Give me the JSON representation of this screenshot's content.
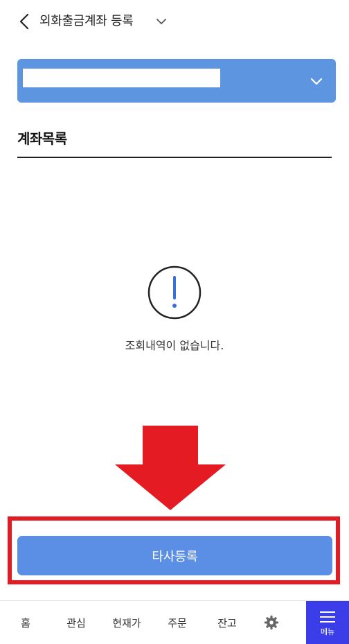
{
  "header": {
    "title": "외화출금계좌 등록"
  },
  "account_select": {
    "value": ""
  },
  "section": {
    "title": "계좌목록"
  },
  "empty_state": {
    "message": "조회내역이 없습니다."
  },
  "register_button": {
    "label": "타사등록"
  },
  "bottom_nav": {
    "home": "홈",
    "watchlist": "관심",
    "current_price": "현재가",
    "order": "주문",
    "balance": "잔고",
    "settings_icon": "gear-icon",
    "menu": "메뉴"
  },
  "colors": {
    "accent_blue": "#5b8fe6",
    "select_blue": "#5d95e1",
    "menu_purple": "#3b3de8",
    "annotation_red": "#e41b23"
  }
}
